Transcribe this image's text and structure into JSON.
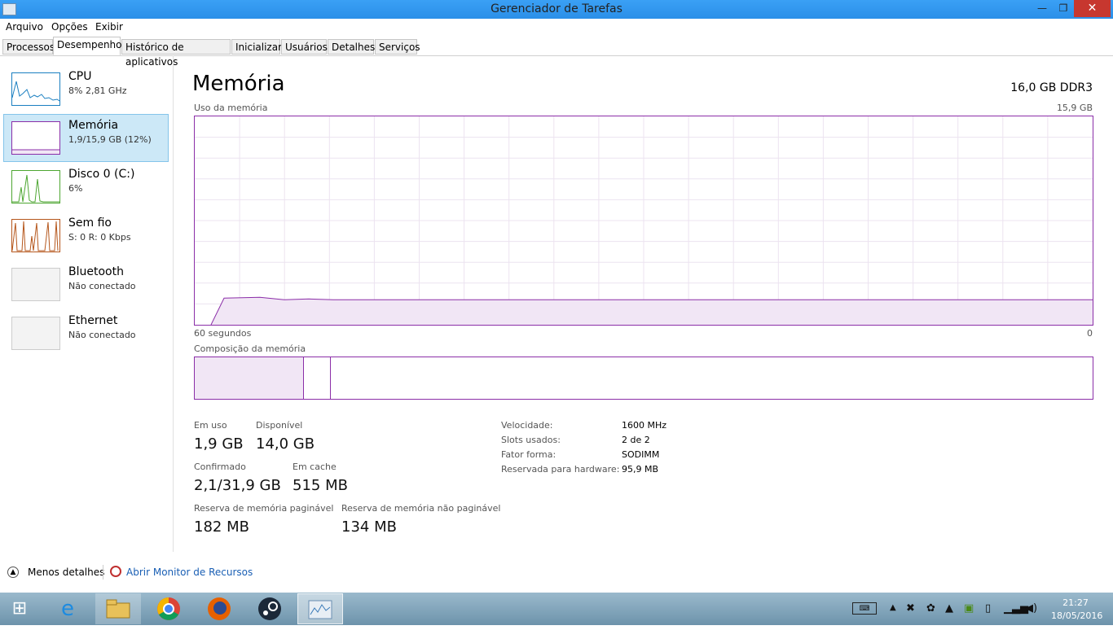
{
  "window": {
    "title": "Gerenciador de Tarefas",
    "minimize": "—",
    "maximize": "❐",
    "close": "✕"
  },
  "menu": [
    "Arquivo",
    "Opções",
    "Exibir"
  ],
  "tabs": [
    "Processos",
    "Desempenho",
    "Histórico de aplicativos",
    "Inicializar",
    "Usuários",
    "Detalhes",
    "Serviços"
  ],
  "active_tab": "Desempenho",
  "sidebar": {
    "items": [
      {
        "name": "CPU",
        "detail": "8% 2,81 GHz",
        "color": "#1a7fc1",
        "icon": "cpu-graph-icon"
      },
      {
        "name": "Memória",
        "detail": "1,9/15,9 GB (12%)",
        "color": "#8b2ea8",
        "icon": "memory-graph-icon"
      },
      {
        "name": "Disco 0 (C:)",
        "detail": "6%",
        "color": "#4da631",
        "icon": "disk-graph-icon"
      },
      {
        "name": "Sem fio",
        "detail": "S: 0 R: 0 Kbps",
        "color": "#b5561b",
        "icon": "wifi-graph-icon"
      },
      {
        "name": "Bluetooth",
        "detail": "Não conectado",
        "color": "#999999",
        "icon": "bluetooth-graph-icon"
      },
      {
        "name": "Ethernet",
        "detail": "Não conectado",
        "color": "#999999",
        "icon": "ethernet-graph-icon"
      }
    ]
  },
  "main": {
    "title": "Memória",
    "total": "16,0 GB DDR3",
    "usage_label": "Uso da memória",
    "usage_max": "15,9 GB",
    "time_left": "60 segundos",
    "time_right": "0",
    "composition_label": "Composição da memória",
    "usage_fraction": 0.12,
    "accent_color": "#8b2ea8",
    "stats": {
      "in_use_label": "Em uso",
      "in_use": "1,9 GB",
      "available_label": "Disponível",
      "available": "14,0 GB",
      "committed_label": "Confirmado",
      "committed": "2,1/31,9 GB",
      "cached_label": "Em cache",
      "cached": "515 MB",
      "paged_label": "Reserva de memória paginável",
      "paged": "182 MB",
      "nonpaged_label": "Reserva de memória não paginável",
      "nonpaged": "134 MB"
    },
    "specs": {
      "speed_label": "Velocidade:",
      "speed": "1600 MHz",
      "slots_label": "Slots usados:",
      "slots": "2 de 2",
      "form_label": "Fator forma:",
      "form": "SODIMM",
      "reserved_label": "Reservada para hardware:",
      "reserved": "95,9 MB"
    }
  },
  "footer": {
    "less_details": "Menos detalhes",
    "open_monitor": "Abrir Monitor de Recursos"
  },
  "taskbar": {
    "apps": [
      "start-icon",
      "internet-explorer-icon",
      "file-explorer-icon",
      "chrome-icon",
      "firefox-icon",
      "steam-icon",
      "task-manager-icon"
    ],
    "time": "21:27",
    "date": "18/05/2016"
  }
}
